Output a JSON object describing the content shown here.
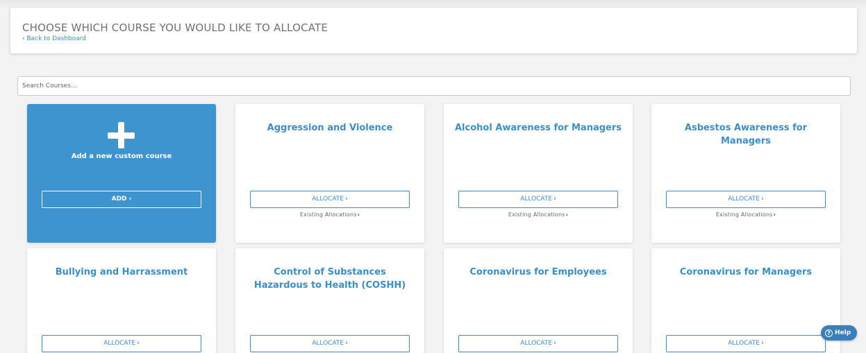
{
  "header": {
    "title": "CHOOSE WHICH COURSE YOU WOULD LIKE TO ALLOCATE",
    "back_link": "‹ Back to Dashboard"
  },
  "search": {
    "placeholder": "Search Courses..."
  },
  "custom_course": {
    "label": "Add a new custom course",
    "button": "ADD"
  },
  "buttons": {
    "allocate": "ALLOCATE",
    "existing": "Existing Allocations"
  },
  "courses": [
    {
      "title": "Aggression and Violence"
    },
    {
      "title": "Alcohol Awareness for Managers"
    },
    {
      "title": "Asbestos Awareness for Managers"
    },
    {
      "title": "Bullying and Harrassment"
    },
    {
      "title": "Control of Substances Hazardous to Health (COSHH)"
    },
    {
      "title": "Coronavirus for Employees"
    },
    {
      "title": "Coronavirus for Managers"
    }
  ],
  "help": {
    "label": "Help",
    "icon": "question-circle-icon"
  },
  "colors": {
    "accent": "#3a8fc8",
    "custom_card": "#3e94cf",
    "help": "#3a7fb8"
  }
}
